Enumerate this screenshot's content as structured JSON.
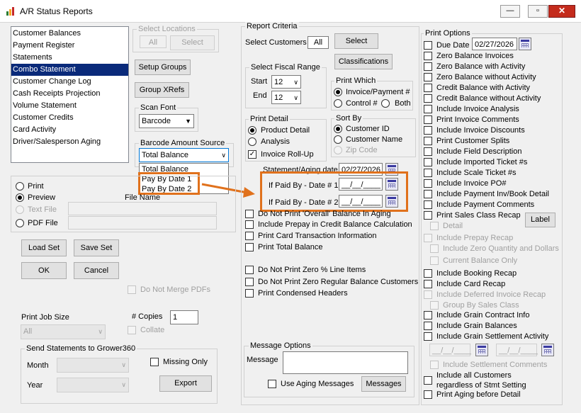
{
  "window": {
    "title": "A/R Status Reports",
    "minimize_icon": "minimize-icon",
    "maximize_icon": "maximize-icon",
    "close_icon": "close-icon"
  },
  "report_list": {
    "items": [
      "Customer Balances",
      "Payment Register",
      "Statements",
      "Combo Statement",
      "Customer Change Log",
      "Cash Receipts Projection",
      "Volume Statement",
      "Customer Credits",
      "Card Activity",
      "Driver/Salesperson Aging"
    ],
    "selected": "Combo Statement"
  },
  "select_locations": {
    "label": "Select Locations",
    "value": "All",
    "button": "Select"
  },
  "setup_groups": "Setup Groups",
  "group_xrefs": "Group XRefs",
  "scan_font": {
    "label": "Scan Font",
    "value": "Barcode"
  },
  "barcode_source": {
    "label": "Barcode Amount Source",
    "value": "Total Balance",
    "options": [
      "Total Balance",
      "Pay By Date 1",
      "Pay By Date 2"
    ]
  },
  "output": {
    "print": "Print",
    "preview": "Preview",
    "text_file": "Text File",
    "pdf_file": "PDF File",
    "file_name_label": "File Name",
    "selected": "Preview"
  },
  "buttons": {
    "load_set": "Load Set",
    "save_set": "Save Set",
    "ok": "OK",
    "cancel": "Cancel"
  },
  "do_not_merge_pdfs": "Do Not Merge PDFs",
  "print_job_size": {
    "label": "Print Job Size",
    "value": "All"
  },
  "copies": {
    "label": "# Copies",
    "value": "1"
  },
  "collate": "Collate",
  "grower360": {
    "label": "Send Statements to Grower360",
    "month": "Month",
    "year": "Year",
    "missing_only": "Missing Only",
    "export": "Export"
  },
  "report_criteria": {
    "label": "Report Criteria",
    "select_customers": "Select Customers",
    "customers_value": "All",
    "select_button": "Select",
    "classifications_button": "Classifications"
  },
  "fiscal_range": {
    "label": "Select Fiscal Range",
    "start_label": "Start",
    "start": "12",
    "end_label": "End",
    "end": "12"
  },
  "print_which": {
    "label": "Print Which",
    "invoice_payment": "Invoice/Payment #",
    "control": "Control #",
    "both": "Both",
    "selected": "Invoice/Payment #"
  },
  "print_detail": {
    "label": "Print Detail",
    "product_detail": "Product Detail",
    "analysis": "Analysis",
    "invoice_rollup": "Invoice Roll-Up",
    "selected": "Product Detail",
    "invoice_rollup_checked": true
  },
  "sort_by": {
    "label": "Sort By",
    "customer_id": "Customer ID",
    "customer_name": "Customer Name",
    "zip_code": "Zip Code",
    "selected": "Customer ID"
  },
  "statement_aging_date": {
    "label": "Statement/Aging date",
    "value": "02/27/2026"
  },
  "paid_by_1": {
    "label": "If Paid By - Date # 1",
    "value": "__/__/____"
  },
  "paid_by_2": {
    "label": "If Paid By - Date # 2",
    "value": "__/__/____"
  },
  "criteria_checks": [
    "Do Not Print 'Overall' Balance In Aging",
    "Include Prepay in Credit Balance Calculation",
    "Print Card Transaction Information",
    "Print Total Balance",
    "Do Not Print Zero % Line Items",
    "Do Not Print Zero Regular Balance Customers",
    "Print Condensed Headers"
  ],
  "message_options": {
    "label": "Message Options",
    "message": "Message",
    "use_aging_messages": "Use Aging Messages",
    "messages_button": "Messages"
  },
  "print_options": {
    "label": "Print Options",
    "due_date_label": "Due Date",
    "due_date": "02/27/2026",
    "checks": [
      "Zero Balance Invoices",
      "Zero Balance with Activity",
      "Zero Balance without Activity",
      "Credit Balance with Activity",
      "Credit Balance without Activity",
      "Include Invoice Analysis",
      "Print Invoice Comments",
      "Include Invoice Discounts",
      "Print Customer Splits",
      "Include Field Description",
      "Include Imported Ticket #s",
      "Include Scale Ticket #s",
      "Include Invoice PO#",
      "Include Payment Inv/Book Detail",
      "Include Payment Comments",
      "Print Sales Class Recap"
    ],
    "label_button": "Label",
    "detail": "Detail",
    "include_prepay_recap": "Include Prepay Recap",
    "include_zero_qty": "Include Zero Quantity and Dollars",
    "current_balance_only": "Current Balance Only",
    "include_booking_recap": "Include Booking Recap",
    "include_card_recap": "Include Card Recap",
    "include_deferred_recap": "Include Deferred Invoice Recap",
    "group_by_sales_class": "Group By Sales Class",
    "include_grain_contract": "Include Grain Contract Info",
    "include_grain_balances": "Include Grain Balances",
    "include_grain_settlement": "Include Grain Settlement Activity",
    "settle_from": "__/__/____",
    "settle_to": "__/__/____",
    "include_settlement_comments": "Include Settlement Comments",
    "include_all_customers_1": "Include all Customers",
    "include_all_customers_2": "regardless of Stmt Setting",
    "print_aging_before_detail": "Print Aging before Detail"
  },
  "colors": {
    "highlight_orange": "#e0711c",
    "selection_blue": "#0a2a7a"
  }
}
